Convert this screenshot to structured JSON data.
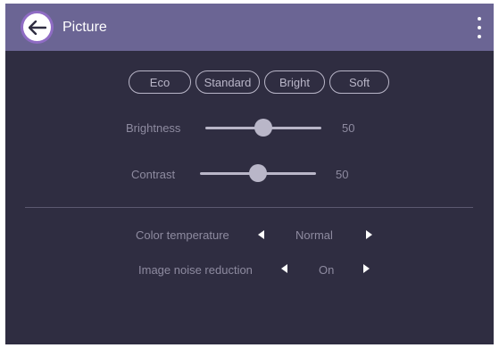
{
  "header": {
    "title": "Picture",
    "back_icon": "arrow-left-icon",
    "more_icon": "more-vertical-icon"
  },
  "presets": [
    "Eco",
    "Standard",
    "Bright",
    "Soft"
  ],
  "sliders": [
    {
      "label": "Brightness",
      "value": "50"
    },
    {
      "label": "Contrast",
      "value": "50"
    }
  ],
  "selectors": [
    {
      "label": "Color temperature",
      "value": "Normal"
    },
    {
      "label": "Image noise reduction",
      "value": "On"
    }
  ],
  "colors": {
    "background": "#2f2d41",
    "header": "#6b6594",
    "accent_ring": "#8f6cc4",
    "control": "#b9b6c8"
  }
}
